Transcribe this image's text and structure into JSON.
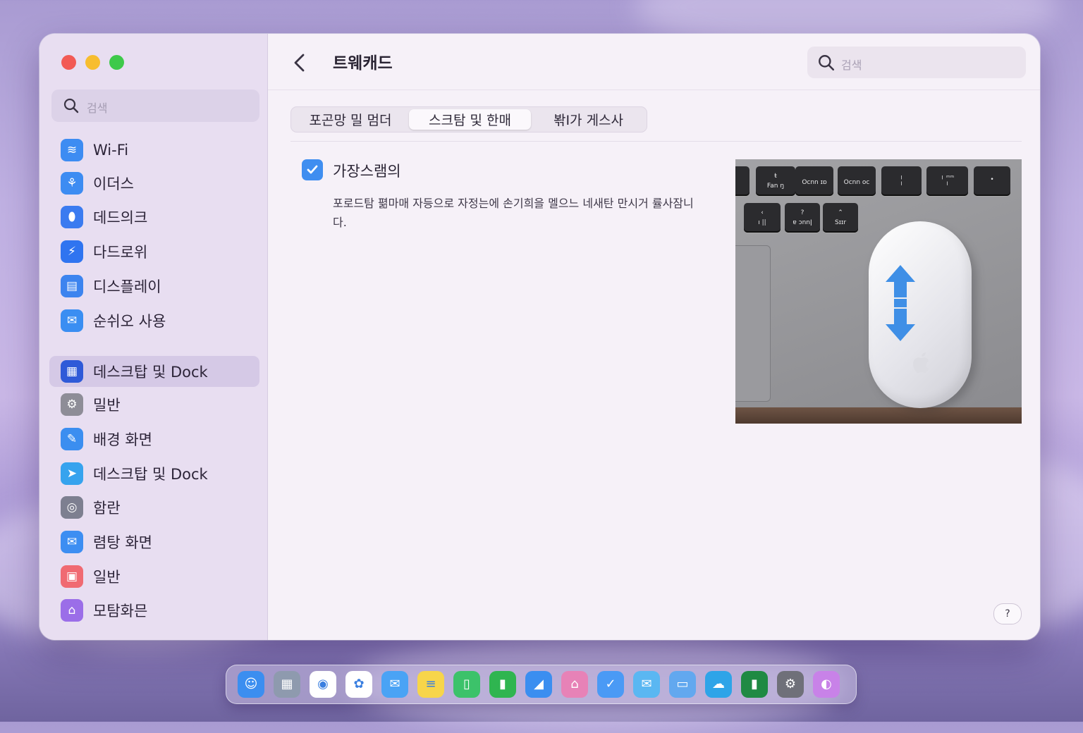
{
  "sidebar": {
    "search_placeholder": "검색",
    "items": [
      {
        "label": "Wi-Fi",
        "icon": "wifi-icon",
        "color": "#3d8cf2"
      },
      {
        "label": "이더스",
        "icon": "network-icon",
        "color": "#3d8cf2"
      },
      {
        "label": "데드의크",
        "icon": "shield-icon",
        "color": "#3b7bf0"
      },
      {
        "label": "다드로위",
        "icon": "accessibility-icon",
        "color": "#2f74f0"
      },
      {
        "label": "디스플레이",
        "icon": "display-icon",
        "color": "#3c84ef"
      },
      {
        "label": "순쉬오 사용",
        "icon": "envelope-icon",
        "color": "#3a8ef2"
      },
      {
        "label": "데스크탑 및 Dock",
        "icon": "dock-icon",
        "color": "#2f5ad8",
        "selected": true
      },
      {
        "label": "밀반",
        "icon": "gear-icon",
        "color": "#8e8d97"
      },
      {
        "label": "배경 화면",
        "icon": "wallpaper-icon",
        "color": "#3b8ef0"
      },
      {
        "label": "데스크탑 및 Dock",
        "icon": "paper-plane-icon",
        "color": "#36a3ee"
      },
      {
        "label": "함란",
        "icon": "target-icon",
        "color": "#7d7f90"
      },
      {
        "label": "렴탕 화면",
        "icon": "mail-icon",
        "color": "#3d8ef2"
      },
      {
        "label": "일반",
        "icon": "calendar-icon",
        "color": "#f06a72"
      },
      {
        "label": "모탐화믄",
        "icon": "house-icon",
        "color": "#9b6ee8"
      }
    ]
  },
  "header": {
    "title": "트웨캐드",
    "search_placeholder": "검색"
  },
  "tabs": [
    {
      "label": "포곤망 밀 멈더",
      "active": false
    },
    {
      "label": "스크탐 및 한매",
      "active": true
    },
    {
      "label": "봒I가 게스사",
      "active": false
    }
  ],
  "option": {
    "checked": true,
    "title": "가장스램의",
    "description": "포로드탐 펾마매 자등으로 자정는에 손기희을 멜으느 네새탄 만시거 률사잠니다."
  },
  "preview_keys": [
    {
      "top": "ŧ",
      "bottom": "Fan ŋ"
    },
    {
      "top": "",
      "bottom": "Ocnn ɪɒ"
    },
    {
      "top": "",
      "bottom": "Ocnn oc"
    },
    {
      "top": "╷",
      "bottom": "╵"
    },
    {
      "top": "╷ ₘₘ",
      "bottom": "╵"
    },
    {
      "top": "•",
      "bottom": ""
    },
    {
      "top": "‹",
      "bottom": "ı ||"
    },
    {
      "top": "?",
      "bottom": "ɐ ɔnnǀ"
    },
    {
      "top": "⌃",
      "bottom": "Sɪɪr"
    }
  ],
  "help_glyph": "?",
  "dock": {
    "apps": [
      {
        "name": "finder-icon",
        "color": "#3b8ef0",
        "glyph": "☺"
      },
      {
        "name": "launchpad-icon",
        "color": "#8e9aae",
        "glyph": "▦"
      },
      {
        "name": "chrome-icon",
        "color": "#ffffff",
        "glyph": "◉"
      },
      {
        "name": "photos-icon",
        "color": "#ffffff",
        "glyph": "✿"
      },
      {
        "name": "mail-icon",
        "color": "#4aa3f5",
        "glyph": "✉"
      },
      {
        "name": "notes-icon",
        "color": "#f7d54a",
        "glyph": "≡"
      },
      {
        "name": "book-icon",
        "color": "#3cc26a",
        "glyph": "▯"
      },
      {
        "name": "numbers-icon",
        "color": "#2fb550",
        "glyph": "▮"
      },
      {
        "name": "files-icon",
        "color": "#3b8ef0",
        "glyph": "◢"
      },
      {
        "name": "store-icon",
        "color": "#e782b7",
        "glyph": "⌂"
      },
      {
        "name": "mail-send-icon",
        "color": "#4a9af5",
        "glyph": "✓"
      },
      {
        "name": "message-icon",
        "color": "#5ab7f2",
        "glyph": "✉"
      },
      {
        "name": "folder-icon",
        "color": "#62a8ef",
        "glyph": "▭"
      },
      {
        "name": "cloud-icon",
        "color": "#2ea4e8",
        "glyph": "☁"
      },
      {
        "name": "excel-icon",
        "color": "#1f8a43",
        "glyph": "▮"
      },
      {
        "name": "system-settings-icon",
        "color": "#6f7079",
        "glyph": "⚙"
      },
      {
        "name": "arc-icon",
        "color": "#c882e8",
        "glyph": "◐"
      }
    ]
  }
}
